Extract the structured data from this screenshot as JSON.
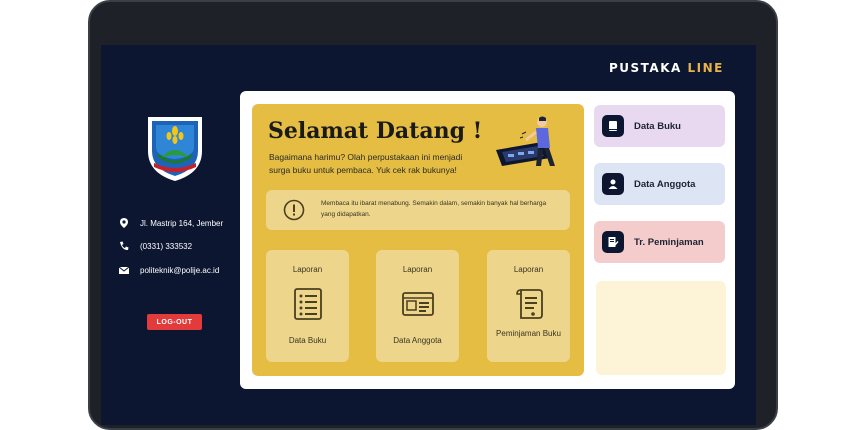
{
  "app": {
    "brand_main": "PUSTAKA",
    "brand_accent": "LINE"
  },
  "sidebar": {
    "contacts": [
      {
        "icon": "location-pin-icon",
        "text": "Jl. Mastrip 164, Jember"
      },
      {
        "icon": "phone-icon",
        "text": "(0331) 333532"
      },
      {
        "icon": "mail-icon",
        "text": "politeknik@polije.ac.id"
      }
    ],
    "logout_label": "LOG-OUT"
  },
  "hero": {
    "title": "Selamat Datang !",
    "subtitle": "Bagaimana harimu? Olah perpustakaan ini menjadi surga buku untuk pembaca. Yuk cek rak bukunya!",
    "alert": "Membaca itu ibarat menabung. Semakin dalam, semakin banyak hal berharga yang didapatkan."
  },
  "reports": [
    {
      "top": "Laporan",
      "bottom": "Data Buku",
      "icon": "list-document-icon"
    },
    {
      "top": "Laporan",
      "bottom": "Data Anggota",
      "icon": "id-card-icon"
    },
    {
      "top": "Laporan",
      "bottom": "Peminjaman Buku",
      "icon": "scroll-document-icon"
    }
  ],
  "menu": [
    {
      "label": "Data Buku",
      "icon": "book-icon",
      "color": "#e8d9f1"
    },
    {
      "label": "Data Anggota",
      "icon": "user-icon",
      "color": "#dde4f3"
    },
    {
      "label": "Tr. Peminjaman",
      "icon": "edit-document-icon",
      "color": "#f4cccc"
    }
  ],
  "colors": {
    "accent": "#e8b447",
    "hero": "#e4bd42",
    "logout": "#e13b3b",
    "screen": "#0c1631"
  }
}
